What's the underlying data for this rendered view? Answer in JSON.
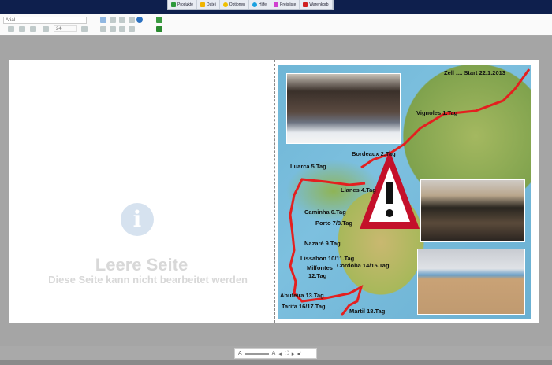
{
  "menu": {
    "items": [
      {
        "label": "Produkte",
        "color": "#2e9a3c"
      },
      {
        "label": "Datei",
        "color": "#f0b400"
      },
      {
        "label": "Optionen",
        "color": "#f0c000"
      },
      {
        "label": "Hilfe",
        "color": "#1aa0e0"
      },
      {
        "label": "Preisliste",
        "color": "#d040d0"
      },
      {
        "label": "Warenkorb",
        "color": "#d02020"
      }
    ]
  },
  "toolbar": {
    "font": "Arial",
    "size": "24"
  },
  "left_page": {
    "title": "Leere Seite",
    "hint": "Diese Seite kann nicht bearbeitet werden"
  },
  "map": {
    "labels": [
      "Zell .... Start 22.1.2013",
      "Vignoles  1.Tag",
      "Bordeaux  2.Tag",
      "Luarca  5.Tag",
      "Llanes  4.Tag",
      "Caminha  6.Tag",
      "Porto  7/8.Tag",
      "Nazaré  9.Tag",
      "Lissabon  10/11.Tag",
      "Milfontes",
      "12.Tag",
      "Cordoba  14/15.Tag",
      "Abufeira  13.Tag",
      "Tarifa  16/17.Tag",
      "Martil  18.Tag"
    ]
  }
}
